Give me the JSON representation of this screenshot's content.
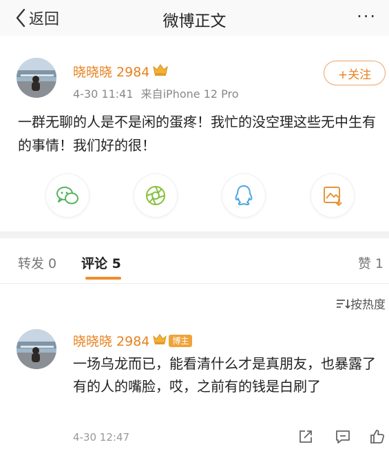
{
  "nav": {
    "back_label": "返回",
    "title": "微博正文",
    "more": "···"
  },
  "post": {
    "username": "晓晓晓 2984",
    "time": "4-30 11:41",
    "source": "来自iPhone 12 Pro",
    "follow_label": "+关注",
    "text": "一群无聊的人是不是闲的蛋疼！我忙的没空理这些无中生有的事情！我们好的很！"
  },
  "share_icons": [
    "wechat-icon",
    "moments-icon",
    "qq-icon",
    "save-image-icon"
  ],
  "tabs": {
    "repost": "转发 0",
    "comment": "评论 5",
    "like": "赞 1"
  },
  "sort_label": "按热度",
  "comment": {
    "username": "晓晓晓 2984",
    "badge": "博主",
    "text": "一场乌龙而已，能看清什么才是真朋友，也暴露了有的人的嘴脸，哎，之前有的钱是白刷了",
    "time": "4-30 12:47"
  },
  "colors": {
    "accent": "#e8801d",
    "tab_indicator": "#f08c2a"
  }
}
